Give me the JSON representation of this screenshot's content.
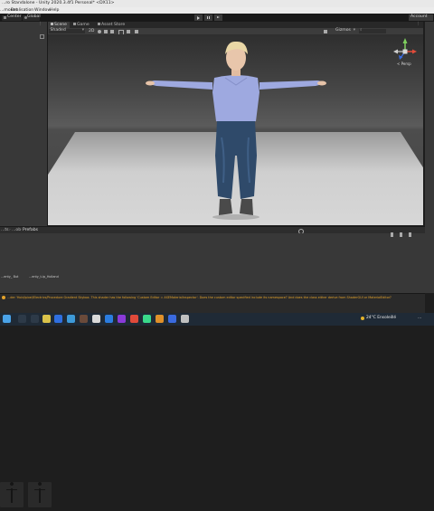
{
  "window": {
    "title": "...ro Standalone - Unity 2020.3.4f1 Personal* <DX11>"
  },
  "menu": [
    "...mount",
    "Realisation",
    "Window",
    "Help"
  ],
  "toolbar": {
    "center_label": "Center",
    "global_label": "Global",
    "account_label": "Account"
  },
  "scene_tabs": [
    "Scene",
    "Game",
    "Asset Store"
  ],
  "scene_tools": {
    "shading_mode": "Shaded",
    "mode_2d": "2D",
    "gizmos": "Gizmos"
  },
  "gizmo": {
    "persp_label": "< Persp"
  },
  "project": {
    "breadcrumb": [
      "...ts",
      "...ob",
      "Prefabs"
    ],
    "assets": [
      "...enty_ But",
      "...enty_t-ip_Holland"
    ]
  },
  "console": {
    "message": "...der 'Hold/pixel/Electrics/Procedure Gradient Skybox. This shader has the following 'Custom Editor = ASEMaterialInspector'. Does the custom editor specified include its namespace? And does the class either derive from ShaderGUI or MaterialEditor?"
  },
  "taskbar": {
    "weather": "24°C Ensoleillé",
    "time": "..."
  },
  "colors": {
    "accent": "#3a79bb",
    "sweater": "#9ea9e0",
    "jeans": "#2f4a6a",
    "warning": "#e3a22a"
  }
}
